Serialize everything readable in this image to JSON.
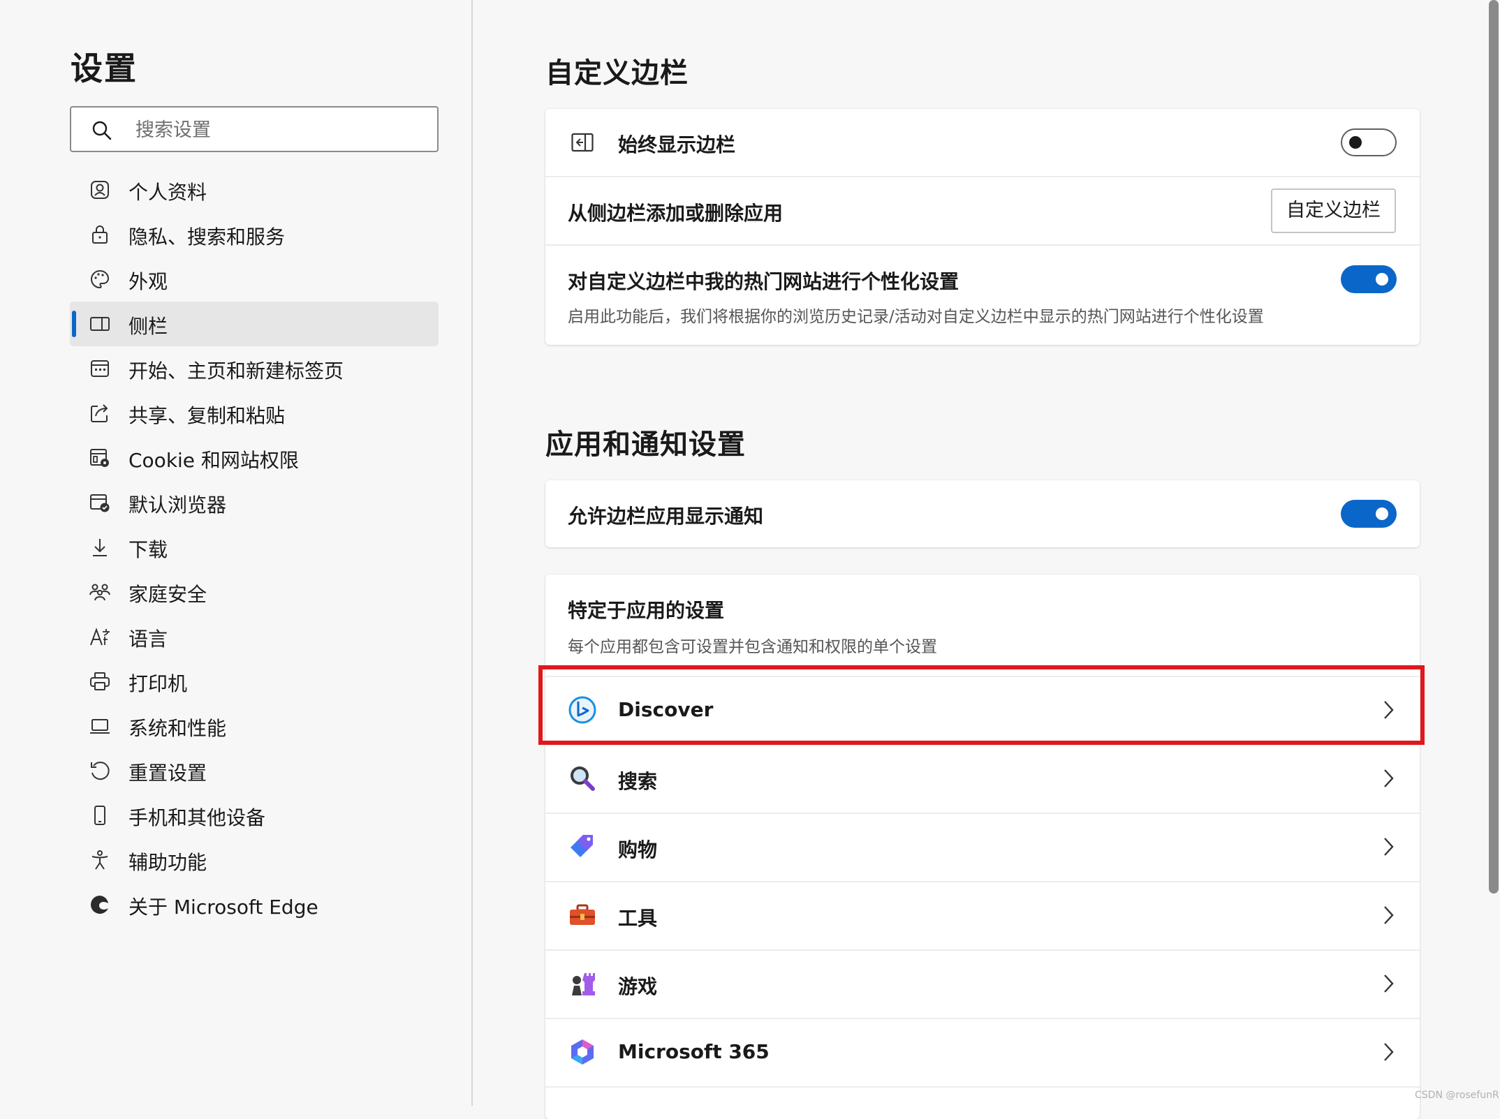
{
  "sidebar": {
    "title": "设置",
    "search_placeholder": "搜索设置",
    "items": [
      {
        "label": "个人资料",
        "icon": "profile-icon",
        "active": false
      },
      {
        "label": "隐私、搜索和服务",
        "icon": "lock-icon",
        "active": false
      },
      {
        "label": "外观",
        "icon": "palette-icon",
        "active": false
      },
      {
        "label": "侧栏",
        "icon": "sidebar-panel-icon",
        "active": true
      },
      {
        "label": "开始、主页和新建标签页",
        "icon": "home-tab-icon",
        "active": false
      },
      {
        "label": "共享、复制和粘贴",
        "icon": "share-icon",
        "active": false
      },
      {
        "label": "Cookie 和网站权限",
        "icon": "cookie-permissions-icon",
        "active": false
      },
      {
        "label": "默认浏览器",
        "icon": "default-browser-icon",
        "active": false
      },
      {
        "label": "下载",
        "icon": "download-icon",
        "active": false
      },
      {
        "label": "家庭安全",
        "icon": "family-icon",
        "active": false
      },
      {
        "label": "语言",
        "icon": "language-icon",
        "active": false
      },
      {
        "label": "打印机",
        "icon": "printer-icon",
        "active": false
      },
      {
        "label": "系统和性能",
        "icon": "laptop-icon",
        "active": false
      },
      {
        "label": "重置设置",
        "icon": "reset-icon",
        "active": false
      },
      {
        "label": "手机和其他设备",
        "icon": "phone-icon",
        "active": false
      },
      {
        "label": "辅助功能",
        "icon": "accessibility-icon",
        "active": false
      },
      {
        "label": "关于 Microsoft Edge",
        "icon": "edge-logo-icon",
        "active": false
      }
    ]
  },
  "customize": {
    "title": "自定义边栏",
    "always_show": {
      "label": "始终显示边栏",
      "enabled": false
    },
    "add_remove": {
      "label": "从侧边栏添加或删除应用",
      "button": "自定义边栏"
    },
    "personalize": {
      "label": "对自定义边栏中我的热门网站进行个性化设置",
      "description": "启用此功能后，我们将根据你的浏览历史记录/活动对自定义边栏中显示的热门网站进行个性化设置",
      "enabled": true
    }
  },
  "notifications": {
    "title": "应用和通知设置",
    "allow": {
      "label": "允许边栏应用显示通知",
      "enabled": true
    },
    "specific": {
      "title": "特定于应用的设置",
      "description": "每个应用都包含可设置并包含通知和权限的单个设置"
    },
    "apps": [
      {
        "label": "Discover",
        "icon": "bing-discover-icon"
      },
      {
        "label": "搜索",
        "icon": "magnifier-icon"
      },
      {
        "label": "购物",
        "icon": "shopping-tag-icon"
      },
      {
        "label": "工具",
        "icon": "toolbox-icon"
      },
      {
        "label": "游戏",
        "icon": "chess-icon"
      },
      {
        "label": "Microsoft 365",
        "icon": "microsoft-365-icon"
      }
    ]
  },
  "colors": {
    "accent": "#0a67c9",
    "highlight": "#e0171c"
  },
  "watermark": "CSDN @rosefunR"
}
